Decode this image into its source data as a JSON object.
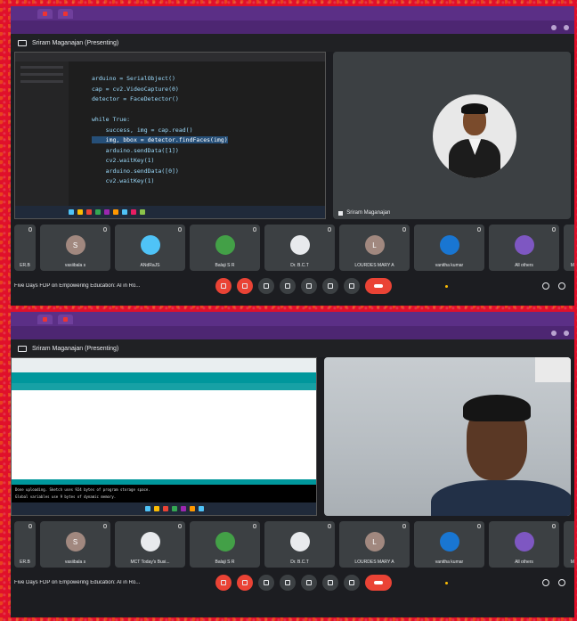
{
  "colors": {
    "background": "#e0102a",
    "browser_purple": "#5b2f86",
    "meet_dark": "#202124",
    "hangup_red": "#ea4335",
    "arduino_teal": "#00979c"
  },
  "top": {
    "meet_title": "Sriram Maganajan (Presenting)",
    "code_lines": [
      "arduino = SerialObject()",
      "cap = cv2.VideoCapture(0)",
      "detector = FaceDetector()",
      "",
      "while True:",
      "    success, img = cap.read()",
      "    img, bbox = detector.findFaces(img)",
      "    arduino.sendData([1])",
      "    cv2.waitKey(1)",
      "    arduino.sendData([0])",
      "    cv2.waitKey(1)"
    ],
    "camera_name": "Sriram Maganajan",
    "participants": [
      {
        "name": "ER.B",
        "initial": "",
        "color": "#3c4043",
        "partial": true
      },
      {
        "name": "vasiibala s",
        "initial": "S",
        "color": "#a1887f"
      },
      {
        "name": "ANdRaJS",
        "initial": "",
        "color": "#4fc3f7"
      },
      {
        "name": "Balaji S R",
        "initial": "",
        "color": "#43a047"
      },
      {
        "name": "Dr. B.C.T",
        "initial": "",
        "color": "#e8eaed"
      },
      {
        "name": "LOURDES MARY A",
        "initial": "L",
        "color": "#a1887f"
      },
      {
        "name": "vanitha kumar",
        "initial": "",
        "color": "#1976d2"
      },
      {
        "name": "All others",
        "initial": "",
        "color": "#7e57c2"
      },
      {
        "name": "MIT",
        "initial": "",
        "color": "#3c4043",
        "partial": true
      }
    ],
    "meeting_name": "Five Days FDP on Empowering Education: AI in Ro..."
  },
  "bottom": {
    "meet_title": "Sriram Maganajan (Presenting)",
    "console_lines": [
      "Done uploading. Sketch uses 924 bytes of program storage space.",
      "Global variables use 9 bytes of dynamic memory."
    ],
    "participants": [
      {
        "name": "ER.B",
        "initial": "",
        "color": "#3c4043",
        "partial": true
      },
      {
        "name": "vasiibala s",
        "initial": "S",
        "color": "#a1887f"
      },
      {
        "name": "MCT Today's Busi...",
        "initial": "",
        "color": "#e8eaed"
      },
      {
        "name": "Balaji S R",
        "initial": "",
        "color": "#43a047"
      },
      {
        "name": "Dr. B.C.T",
        "initial": "",
        "color": "#e8eaed"
      },
      {
        "name": "LOURDES MARY A",
        "initial": "L",
        "color": "#a1887f"
      },
      {
        "name": "vanitha kumar",
        "initial": "",
        "color": "#1976d2"
      },
      {
        "name": "All others",
        "initial": "",
        "color": "#7e57c2"
      },
      {
        "name": "MIT",
        "initial": "",
        "color": "#3c4043",
        "partial": true
      }
    ],
    "meeting_name": "Five Days FDP on Empowering Education: AI in Ro..."
  },
  "icons": [
    "mic-off-icon",
    "camera-off-icon",
    "captions-icon",
    "emoji-icon",
    "present-icon",
    "raise-hand-icon",
    "more-icon",
    "hang-up-icon",
    "info-icon",
    "people-icon"
  ]
}
